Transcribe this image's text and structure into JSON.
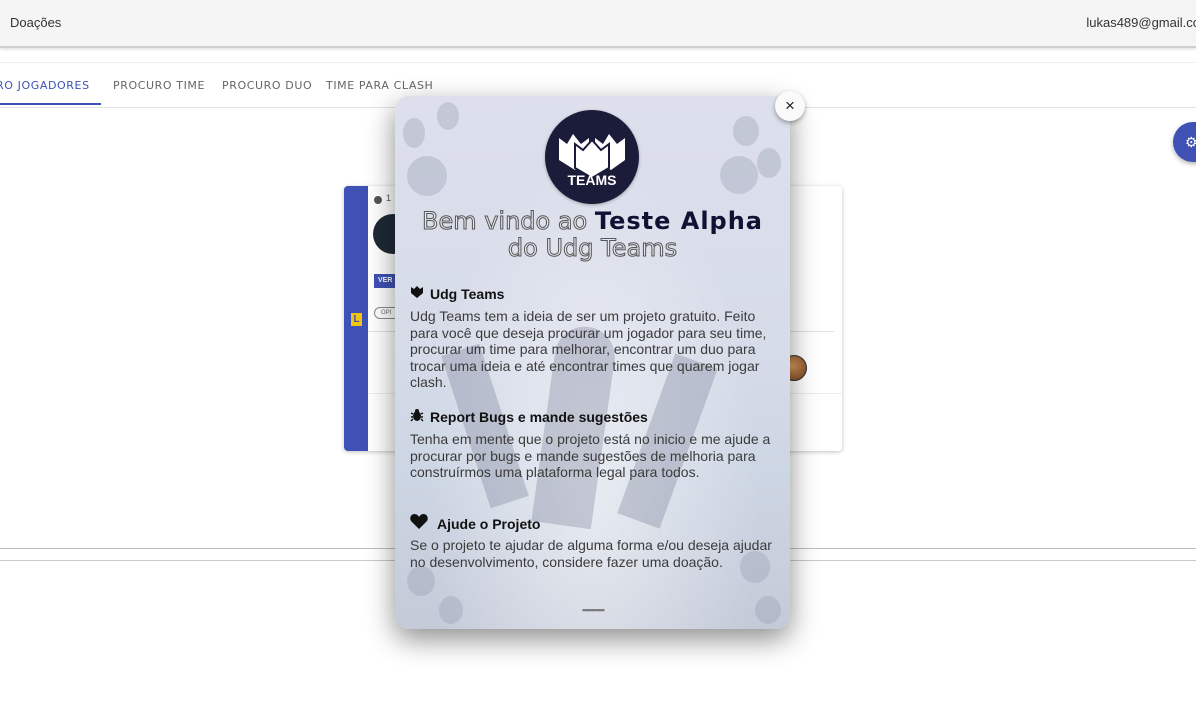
{
  "topbar": {
    "donations_label": "Doações",
    "user_email": "lukas489@gmail.co"
  },
  "tabs": [
    {
      "label": "RO JOGADORES",
      "active": true
    },
    {
      "label": "PROCURO TIME",
      "active": false
    },
    {
      "label": "PROCURO DUO",
      "active": false
    },
    {
      "label": "TIME PARA CLASH",
      "active": false
    }
  ],
  "fab": {
    "icon": "gear-icon"
  },
  "card": {
    "time_text": "1",
    "badge_text": "VER",
    "chip_text": "OPI",
    "game_icon": "league-of-legends-icon"
  },
  "modal": {
    "logo_text": "TEAMS",
    "title_outline_1": "Bem vindo ao",
    "title_bold": "Teste Alpha",
    "title_outline_2": "do Udg Teams",
    "sections": [
      {
        "icon": "shield-icon",
        "title": "Udg Teams",
        "text": "Udg Teams tem a ideia de ser um projeto gratuito. Feito para você que deseja procurar um jogador para seu time, procurar um time para melhorar, encontrar um duo para trocar uma ideia e até encontrar times que quarem jogar clash."
      },
      {
        "icon": "bug-icon",
        "title": "Report Bugs e mande sugestões",
        "text": "Tenha em mente que o projeto está no inicio e me ajude a procurar por bugs e mande sugestões de melhoria para construírmos uma plataforma legal para todos."
      },
      {
        "icon": "heart-icon",
        "title": "Ajude o Projeto",
        "text": "Se o projeto te ajudar de alguma forma e/ou deseja ajudar no desenvolvimento, considere fazer uma doação."
      }
    ],
    "close_label": "×"
  },
  "colors": {
    "primary": "#3f51b5",
    "logo_bg": "#1b1b3a"
  }
}
